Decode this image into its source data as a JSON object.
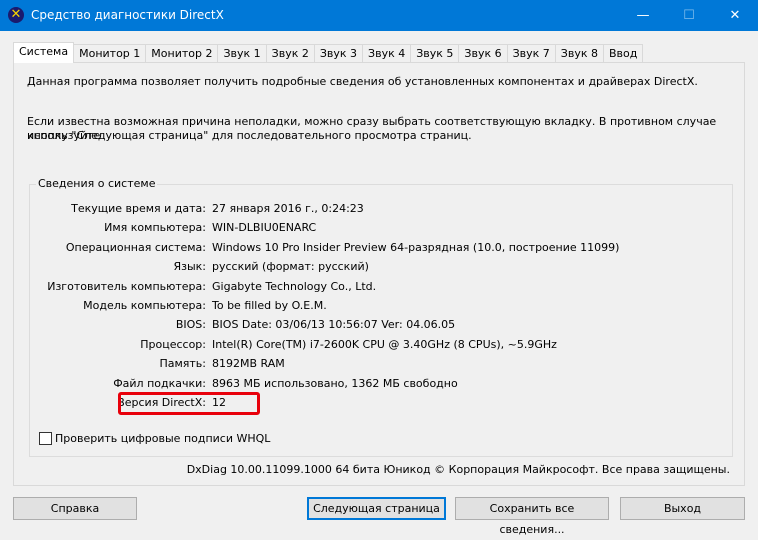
{
  "window": {
    "title": "Средство диагностики DirectX",
    "icon": "directx-x-icon",
    "minimize": "—",
    "maximize": "☐",
    "close": "✕"
  },
  "tabs": [
    {
      "label": "Система",
      "active": true
    },
    {
      "label": "Монитор 1"
    },
    {
      "label": "Монитор 2"
    },
    {
      "label": "Звук 1"
    },
    {
      "label": "Звук 2"
    },
    {
      "label": "Звук 3"
    },
    {
      "label": "Звук 4"
    },
    {
      "label": "Звук 5"
    },
    {
      "label": "Звук 6"
    },
    {
      "label": "Звук 7"
    },
    {
      "label": "Звук 8"
    },
    {
      "label": "Ввод"
    }
  ],
  "intro": "Данная программа позволяет получить подробные сведения об установленных компонентах и драйверах DirectX.",
  "hint_line1": "Если известна возможная причина неполадки, можно сразу выбрать соответствующую вкладку. В противном случае используйте",
  "hint_line2": "кнопку \"Следующая страница\" для последовательного просмотра страниц.",
  "group": {
    "title": "Сведения о системе",
    "rows": [
      {
        "label": "Текущие время и дата:",
        "value": "27 января 2016 г., 0:24:23"
      },
      {
        "label": "Имя компьютера:",
        "value": "WIN-DLBIU0ENARC"
      },
      {
        "label": "Операционная система:",
        "value": "Windows 10 Pro Insider Preview 64-разрядная (10.0, построение 11099)"
      },
      {
        "label": "Язык:",
        "value": "русский (формат: русский)"
      },
      {
        "label": "Изготовитель компьютера:",
        "value": "Gigabyte Technology Co., Ltd."
      },
      {
        "label": "Модель компьютера:",
        "value": "To be filled by O.E.M."
      },
      {
        "label": "BIOS:",
        "value": "BIOS Date: 03/06/13 10:56:07 Ver: 04.06.05"
      },
      {
        "label": "Процессор:",
        "value": "Intel(R) Core(TM) i7-2600K CPU @ 3.40GHz (8 CPUs), ~5.9GHz"
      },
      {
        "label": "Память:",
        "value": "8192MB RAM"
      },
      {
        "label": "Файл подкачки:",
        "value": "8963 МБ использовано, 1362 МБ свободно"
      },
      {
        "label": "Версия DirectX:",
        "value": "12"
      }
    ]
  },
  "whql_checkbox": {
    "label": "Проверить цифровые подписи WHQL",
    "checked": false
  },
  "footer": "DxDiag 10.00.11099.1000 64 бита Юникод © Корпорация Майкрософт. Все права защищены.",
  "buttons": {
    "help": "Справка",
    "next": "Следующая страница",
    "save": "Сохранить все сведения...",
    "exit": "Выход"
  },
  "colors": {
    "titlebar": "#0078d7",
    "highlight": "#e8000b"
  }
}
